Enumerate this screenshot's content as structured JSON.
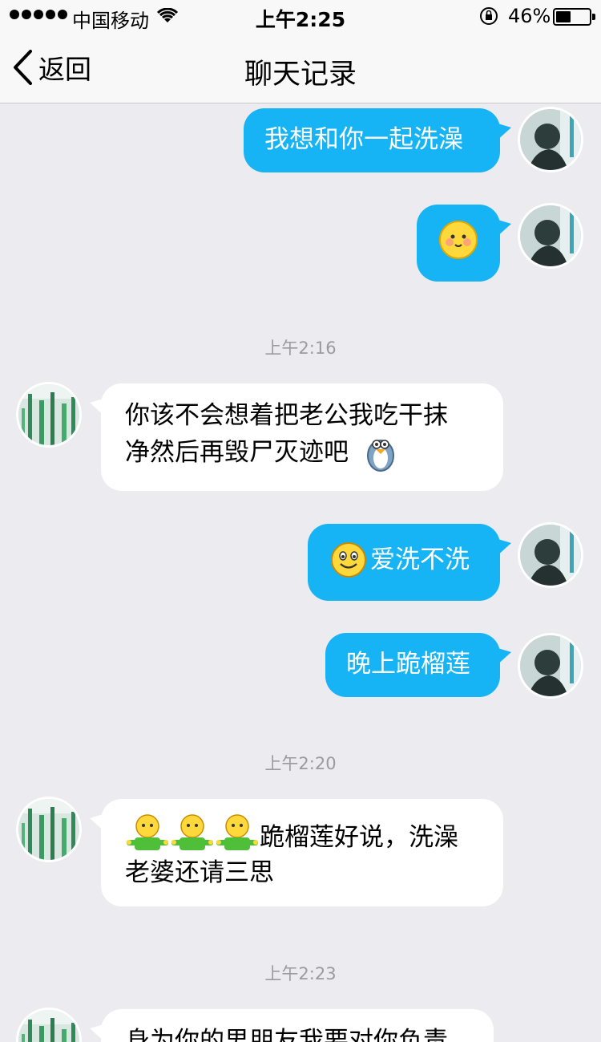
{
  "status": {
    "carrier": "中国移动",
    "time": "上午2:25",
    "battery_pct": "46%",
    "battery_level": 0.46
  },
  "nav": {
    "back_label": "返回",
    "title": "聊天记录"
  },
  "messages": {
    "m1": "我想和你一起洗澡",
    "m3a": "你该不会想着把老公我吃干抹",
    "m3b": "净然后再毁尸灭迹吧",
    "m4": "爱洗不洗",
    "m5": "晚上跪榴莲",
    "m6a": "跪榴莲好说，洗澡",
    "m6b": "老婆还请三思",
    "m7": "身为你的男朋友我要对你负责"
  },
  "timestamps": {
    "t1": "上午2:16",
    "t2": "上午2:20",
    "t3": "上午2:23"
  },
  "colors": {
    "my_bubble": "#16b3f5",
    "their_bubble": "#ffffff",
    "background": "#ebebf0"
  }
}
